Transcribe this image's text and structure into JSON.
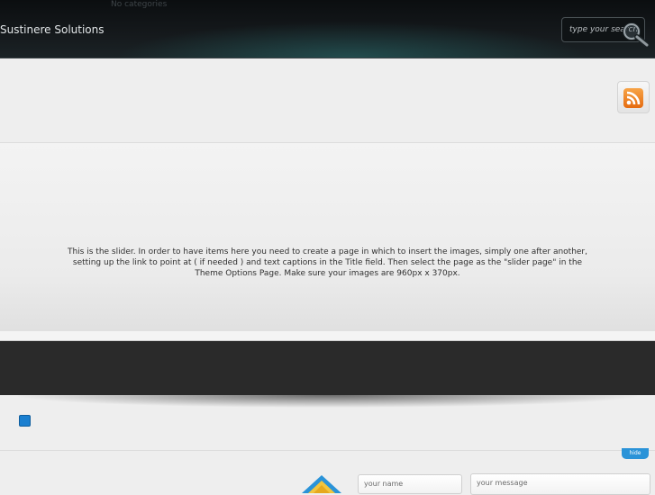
{
  "header": {
    "no_categories": "No categories",
    "brand": "Sustinere Solutions",
    "search_placeholder": "type your search"
  },
  "slider": {
    "text": "This is the slider. In order to have items here you need to create a page in which to insert the images, simply one after another, setting up the link to point at ( if needed ) and text captions in the Title field. Then select the page as the \"slider page\" in the Theme Options Page. Make sure your images are 960px x 370px."
  },
  "footer": {
    "hide_label": "hide",
    "name_placeholder": "your name",
    "message_placeholder": "your message"
  },
  "colors": {
    "header_bg": "#15191c",
    "accent_blue": "#2a93d8",
    "rss_orange": "#f08a24",
    "dark_band": "#2a2a2a"
  },
  "icons": [
    "search-icon",
    "rss-icon",
    "contact-icon"
  ]
}
